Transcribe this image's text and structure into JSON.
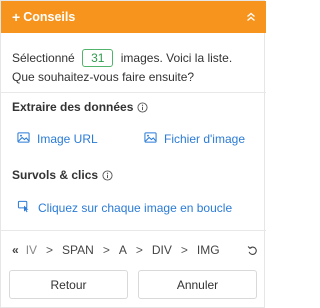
{
  "header": {
    "title": "Conseils",
    "plus_glyph": "+",
    "collapse_icon": "chevrons-up-icon",
    "bg_color": "#f7941d"
  },
  "intro": {
    "prefix": "Sélectionné",
    "count": "31",
    "suffix": "images. Voici la liste. Que souhaitez-vous faire ensuite?"
  },
  "extract": {
    "title": "Extraire des données",
    "info_icon": "info-icon",
    "image_url": "Image URL",
    "image_file": "Fichier d'image"
  },
  "hover": {
    "title": "Survols & clics",
    "info_icon": "info-icon",
    "loop_click": "Cliquez sur chaque image en boucle"
  },
  "breadcrumb": {
    "back": "«",
    "items": [
      "IV",
      "SPAN",
      "A",
      "DIV",
      "IMG"
    ],
    "separator": ">",
    "undo_icon": "undo-icon"
  },
  "buttons": {
    "back": "Retour",
    "cancel": "Annuler"
  },
  "colors": {
    "accent": "#f7941d",
    "link": "#2b7bd6",
    "badge": "#52b36b"
  }
}
